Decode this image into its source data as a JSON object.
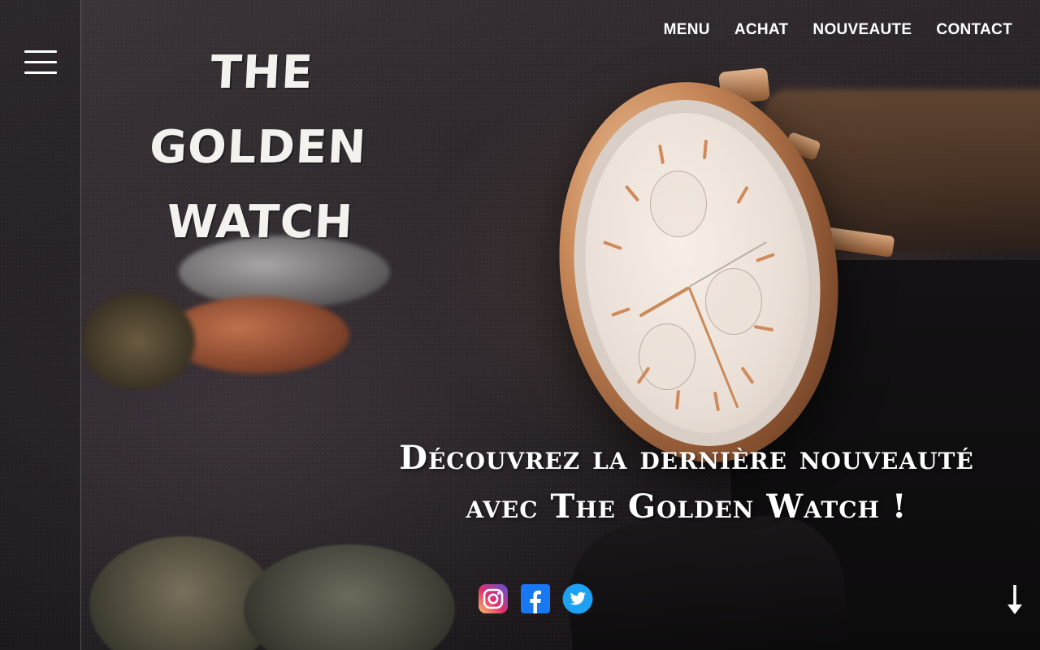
{
  "brand": {
    "logo_line1": "THE GOLDEN",
    "logo_line2": "WATCH"
  },
  "sidebar": {
    "menu_icon": "hamburger-menu-icon"
  },
  "nav": {
    "items": [
      {
        "label": "MENU"
      },
      {
        "label": "ACHAT"
      },
      {
        "label": "NOUVEAUTE"
      },
      {
        "label": "CONTACT"
      }
    ]
  },
  "hero": {
    "headline_line1": "Découvrez la dernière nouveauté",
    "headline_line2": "avec The Golden Watch !"
  },
  "social": {
    "icons": [
      "instagram-icon",
      "facebook-icon",
      "twitter-icon"
    ]
  },
  "scroll": {
    "icon": "arrow-down-icon"
  },
  "colors": {
    "text": "#ffffff",
    "background": "#1a1719",
    "accent_gold": "#c98a5a",
    "facebook": "#1877f2",
    "twitter": "#1da1f2"
  }
}
